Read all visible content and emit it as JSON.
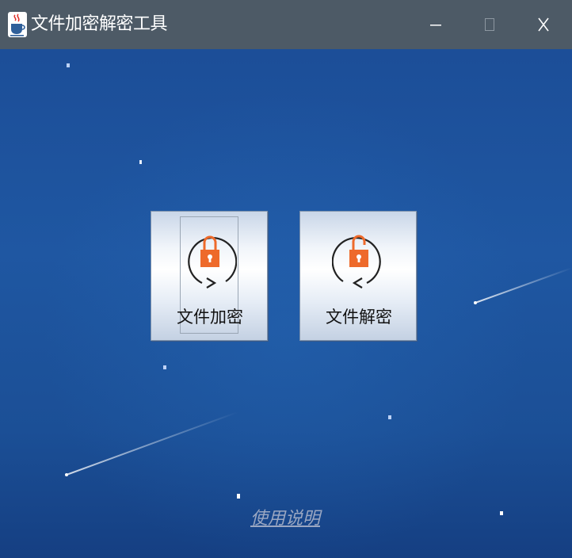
{
  "window": {
    "title": "文件加密解密工具",
    "controls": {
      "minimize": "minimize",
      "maximize": "maximize",
      "close": "close"
    }
  },
  "main": {
    "encrypt_button": {
      "label": "文件加密",
      "icon": "lock-cycle-icon"
    },
    "decrypt_button": {
      "label": "文件解密",
      "icon": "unlock-cycle-icon"
    },
    "help_link": "使用说明"
  },
  "colors": {
    "titlebar": "#4d5a66",
    "background": "#1f57a2",
    "lock_orange": "#ee6a2b",
    "link": "#9aa7c2"
  }
}
